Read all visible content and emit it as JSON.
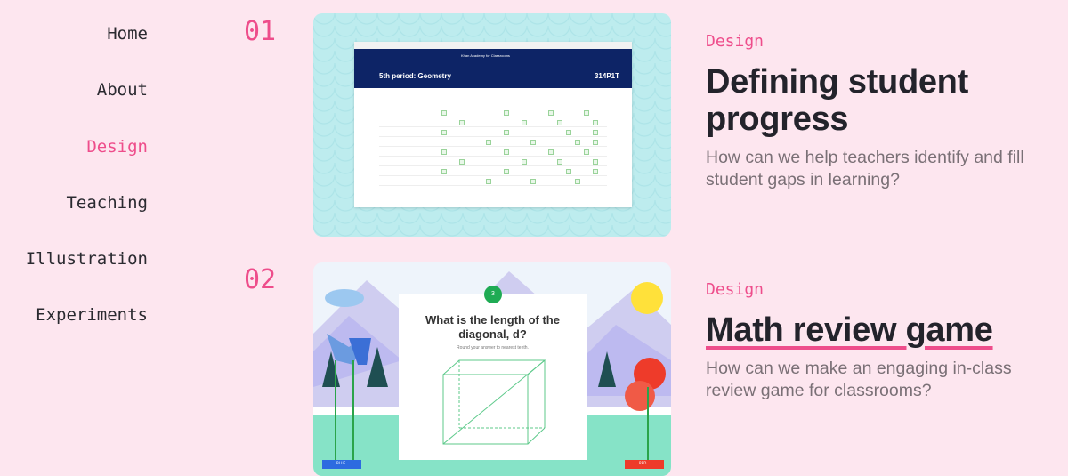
{
  "nav": {
    "items": [
      {
        "label": "Home",
        "active": false
      },
      {
        "label": "About",
        "active": false
      },
      {
        "label": "Design",
        "active": true
      },
      {
        "label": "Teaching",
        "active": false
      },
      {
        "label": "Illustration",
        "active": false
      },
      {
        "label": "Experiments",
        "active": false
      }
    ]
  },
  "colors": {
    "background": "#fde6ef",
    "accent": "#ee4d8b",
    "title": "#23232b",
    "description": "#7a7076"
  },
  "projects": [
    {
      "number": "01",
      "category": "Design",
      "title": "Defining student progress",
      "description": "How can we help teachers identify and fill student gaps in learning?",
      "image": {
        "brand": "Khan Academy for Classrooms",
        "class_title": "5th period: Geometry",
        "class_code": "314P1T"
      }
    },
    {
      "number": "02",
      "category": "Design",
      "title": "Math review game",
      "description": "How can we make an engaging in-class review game for classrooms?",
      "image": {
        "question_number": "3",
        "question": "What is the length of the diagonal, d?",
        "hint": "Round your answer to nearest tenth.",
        "team_left": "BLUE",
        "team_right": "RED"
      }
    }
  ]
}
